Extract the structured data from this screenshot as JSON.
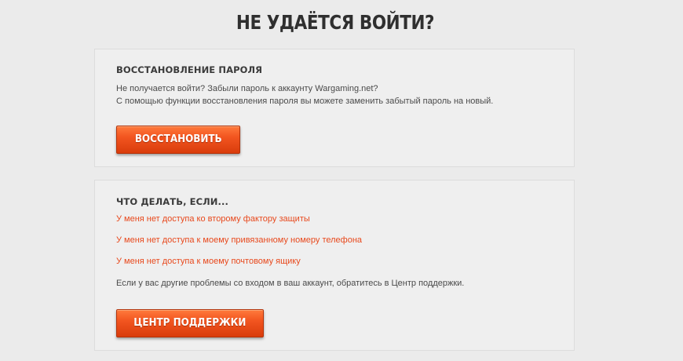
{
  "page": {
    "title": "НЕ УДАЁТСЯ ВОЙТИ?"
  },
  "password_reset": {
    "heading": "ВОССТАНОВЛЕНИЕ ПАРОЛЯ",
    "line1": "Не получается войти? Забыли пароль к аккаунту Wargaming.net?",
    "line2": "С помощью функции восстановления пароля вы можете заменить забытый пароль на новый.",
    "button_label": "ВОССТАНОВИТЬ"
  },
  "help": {
    "heading": "ЧТО ДЕЛАТЬ, ЕСЛИ...",
    "links": [
      "У меня нет доступа ко второму фактору защиты",
      "У меня нет доступа к моему привязанному номеру телефона",
      "У меня нет доступа к моему почтовому ящику"
    ],
    "support_text": "Если у вас другие проблемы со входом в ваш аккаунт, обратитесь в Центр поддержки.",
    "button_label": "ЦЕНТР ПОДДЕРЖКИ"
  },
  "colors": {
    "accent": "#f25520",
    "link": "#e8491d",
    "background": "#ebebeb",
    "panel": "#efefef"
  }
}
